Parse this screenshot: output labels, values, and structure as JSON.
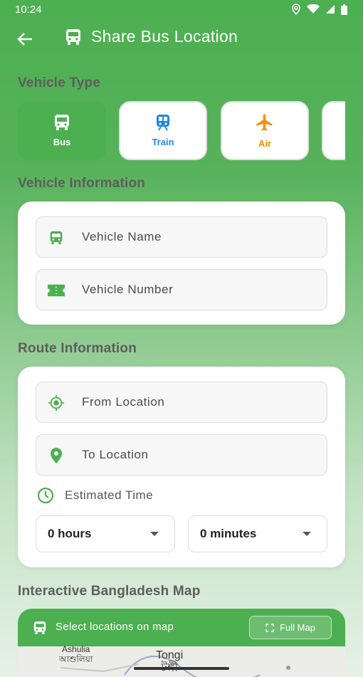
{
  "status_bar": {
    "time": "10:24"
  },
  "app_bar": {
    "title": "Share Bus Location"
  },
  "sections": {
    "vehicle_type": "Vehicle Type",
    "vehicle_information": "Vehicle Information",
    "route_information": "Route Information",
    "map": "Interactive Bangladesh Map"
  },
  "vehicle_types": [
    {
      "label": "Bus",
      "icon": "bus-icon",
      "selected": true
    },
    {
      "label": "Train",
      "icon": "train-icon",
      "selected": false
    },
    {
      "label": "Air",
      "icon": "airplane-icon",
      "selected": false
    }
  ],
  "vehicle_info": {
    "name_placeholder": "Vehicle Name",
    "number_placeholder": "Vehicle Number"
  },
  "route_info": {
    "from_placeholder": "From Location",
    "to_placeholder": "To Location",
    "estimated_time_label": "Estimated Time",
    "hours_value": "0 hours",
    "minutes_value": "0 minutes"
  },
  "map": {
    "header_label": "Select locations on map",
    "full_map_button": "Full Map",
    "places": [
      {
        "name": "Ashulia",
        "native": "আশুলিয়া"
      },
      {
        "name": "Tongi",
        "native": "টঙ্গী"
      }
    ]
  },
  "colors": {
    "primary": "#4caf50",
    "train_accent": "#1e88e5",
    "air_accent": "#fb8c00"
  }
}
